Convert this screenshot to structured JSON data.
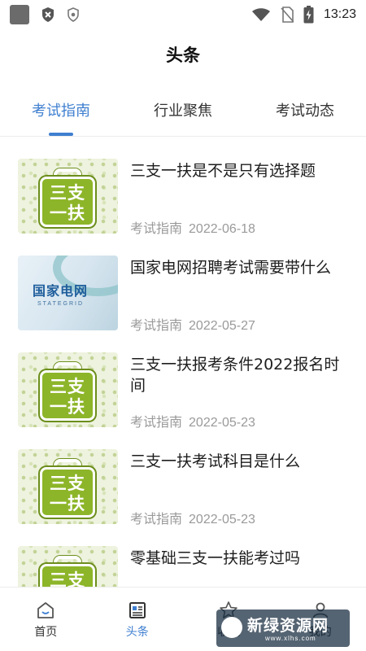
{
  "status_bar": {
    "time": "13:23",
    "icons": [
      "app-square-icon",
      "shield-x-icon",
      "shield-icon",
      "wifi-icon",
      "no-sim-icon",
      "battery-charging-icon"
    ]
  },
  "header": {
    "title": "头条"
  },
  "tabs": [
    {
      "label": "考试指南",
      "active": true
    },
    {
      "label": "行业聚焦",
      "active": false
    },
    {
      "label": "考试动态",
      "active": false
    }
  ],
  "articles": [
    {
      "title": "三支一扶是不是只有选择题",
      "category": "考试指南",
      "date": "2022-06-18",
      "thumb_text": "三支\n一扶"
    },
    {
      "title": "国家电网招聘考试需要带什么",
      "category": "考试指南",
      "date": "2022-05-27",
      "thumb_text": "国家电网",
      "thumb_sub": "STATEGRID"
    },
    {
      "title": "三支一扶报考条件2022报名时间",
      "category": "考试指南",
      "date": "2022-05-23",
      "thumb_text": "三支\n一扶"
    },
    {
      "title": "三支一扶考试科目是什么",
      "category": "考试指南",
      "date": "2022-05-23",
      "thumb_text": "三支\n一扶"
    },
    {
      "title": "零基础三支一扶能考过吗",
      "category": "",
      "date": "",
      "thumb_text": "三支\n一扶"
    }
  ],
  "bottom_nav": [
    {
      "label": "首页",
      "icon": "home-icon",
      "active": false
    },
    {
      "label": "头条",
      "icon": "news-icon",
      "active": true
    },
    {
      "label": "收藏",
      "icon": "star-icon",
      "active": false
    },
    {
      "label": "我的",
      "icon": "user-icon",
      "active": false
    }
  ],
  "watermark": {
    "text": "新绿资源网",
    "url": "www.xlhs.com"
  },
  "colors": {
    "accent": "#3f7fd0",
    "muted": "#9a9a9a",
    "thumb_green": "#8db529"
  }
}
